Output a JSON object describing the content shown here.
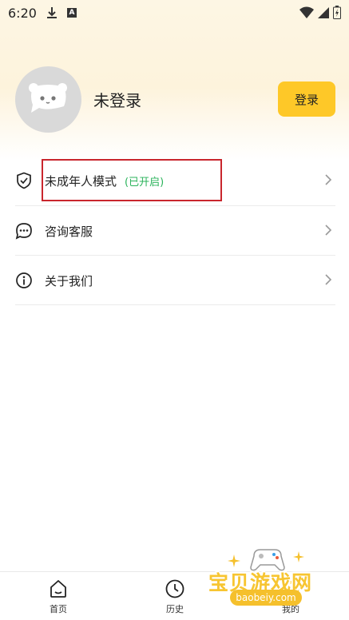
{
  "status_bar": {
    "time": "6:20",
    "a_badge": "A"
  },
  "profile": {
    "name": "未登录",
    "login_button": "登录"
  },
  "menu": [
    {
      "label": "未成年人模式",
      "status": "(已开启)",
      "icon": "shield-check-icon"
    },
    {
      "label": "咨询客服",
      "icon": "chat-bubble-icon"
    },
    {
      "label": "关于我们",
      "icon": "info-icon"
    }
  ],
  "bottom_nav": [
    {
      "label": "首页",
      "icon": "home-icon"
    },
    {
      "label": "历史",
      "icon": "clock-icon"
    },
    {
      "label": "我的",
      "icon": "profile-icon"
    }
  ],
  "watermark": {
    "text": "宝贝游戏网",
    "url": "baobeiy.com"
  },
  "colors": {
    "accent": "#fec828",
    "status_on": "#2bb35b",
    "highlight": "#c9262d"
  }
}
